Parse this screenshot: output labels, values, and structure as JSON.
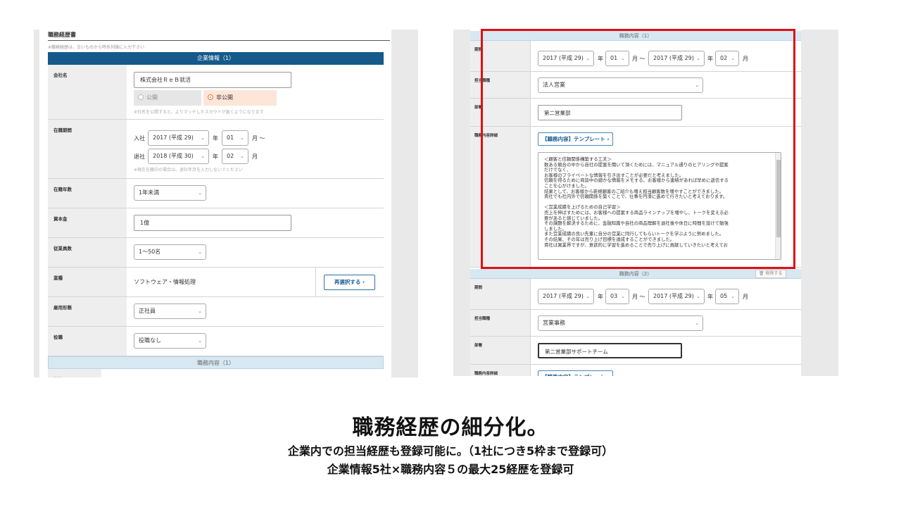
{
  "left": {
    "title": "職務経歴書",
    "note": "※職務経歴は、古いものから時系列順に入力下さい",
    "company_section": "企業情報（1）",
    "rows": {
      "company_name": {
        "label": "会社名",
        "value": "株式会社ＲｅＢ就活",
        "public": "公開",
        "private": "非公開",
        "hint": "※社名を公開すると、よりマッチしたスカウトが届くようになります"
      },
      "period": {
        "label": "在籍期間",
        "join_prefix": "入社",
        "join_year": "2017 (平成 29)",
        "join_month": "01",
        "leave_prefix": "退社",
        "leave_year": "2018 (平成 30)",
        "leave_month": "02",
        "year_unit": "年",
        "month_unit": "月",
        "month_tilde": "月 〜",
        "hint": "※現在在職中の場合は、退社年月を入力しないでください"
      },
      "years": {
        "label": "在籍年数",
        "value": "1年未満"
      },
      "capital": {
        "label": "資本金",
        "value": "1億"
      },
      "employees": {
        "label": "従業員数",
        "value": "1〜50名"
      },
      "industry": {
        "label": "業種",
        "value": "ソフトウェア・情報処理",
        "button": "再選択する ›"
      },
      "employment": {
        "label": "雇用形態",
        "value": "正社員"
      },
      "position": {
        "label": "役職",
        "value": "役職なし"
      }
    },
    "duty_section": "職務内容（1）",
    "cut_label": "期間"
  },
  "right": {
    "duty1": {
      "header": "職務内容（1）",
      "period_label": "期間",
      "from_year": "2017 (平成 29)",
      "from_month": "01",
      "to_year": "2017 (平成 29)",
      "to_month": "02",
      "year_unit": "年",
      "month_tilde": "月 〜",
      "month_unit": "月",
      "role_label": "担当職種",
      "role": "法人営業",
      "dept_label": "部署",
      "dept": "第二営業部",
      "detail_label": "職務内容詳細",
      "template_btn": "【職務内容】テンプレート ›",
      "detail_lines": [
        "＜顧客と信頼関係構築する工夫＞",
        "数ある競合の中から自社の提案を聞いて頂くためには、マニュアル通りのヒアリングや提案",
        "だけでなく、",
        "お客様のプライベートな情報を引き出すことが必要だと考えました。",
        "信頼を得るために商談中の細かな情報をメモする、お客様から連絡があれば早めに返信する",
        "ことを心がけました。",
        "結果として、お客様から新規顧客のご紹介も増え担当顧客数を増やすことができました。",
        "貴社でも社内外で信頼関係を築くことで、仕事を円滑に進めて行きたいと考えております。",
        "",
        "＜営業成績を上げるための自己学習＞",
        "売上を伸ばすためには、お客様への提案する商品ラインナップを増やし、トークを変える必",
        "要があると感じていました。",
        "その課題を解決するために、金融知識や自社の商品理解を退社後や休日に時間を設けて勉強",
        "しました。",
        "また営業成績の良い先輩に自分の営業に同行してもらいトークを学ぶように努めました。",
        "その結果、その年は売り上げ目標を達成することができました。",
        "貴社は異業界ですが、意欲的に学習を進めることで売り上げに貢献していきたいと考えてお"
      ]
    },
    "duty2": {
      "header": "職務内容（2）",
      "delete_btn": "🗑 削除する",
      "period_label": "期間",
      "from_year": "2017 (平成 29)",
      "from_month": "03",
      "to_year": "2017 (平成 29)",
      "to_month": "05",
      "role_label": "担当職種",
      "role": "営業事務",
      "dept_label": "部署",
      "dept": "第二営業部サポートチーム",
      "detail_label": "職務内容詳細",
      "template_btn": "【職務内容】テンプレート ›"
    }
  },
  "caption": {
    "main": "職務経歴の細分化。",
    "sub1": "企業内での担当経歴も登録可能に。（1社につき5枠まで登録可）",
    "sub2": "企業情報5社×職務内容５の最大25経歴を登録可"
  },
  "colors": {
    "header_dark": "#155a8a",
    "header_light": "#d7e8f3",
    "highlight": "#e01010",
    "private_bg": "#fde6d8"
  }
}
